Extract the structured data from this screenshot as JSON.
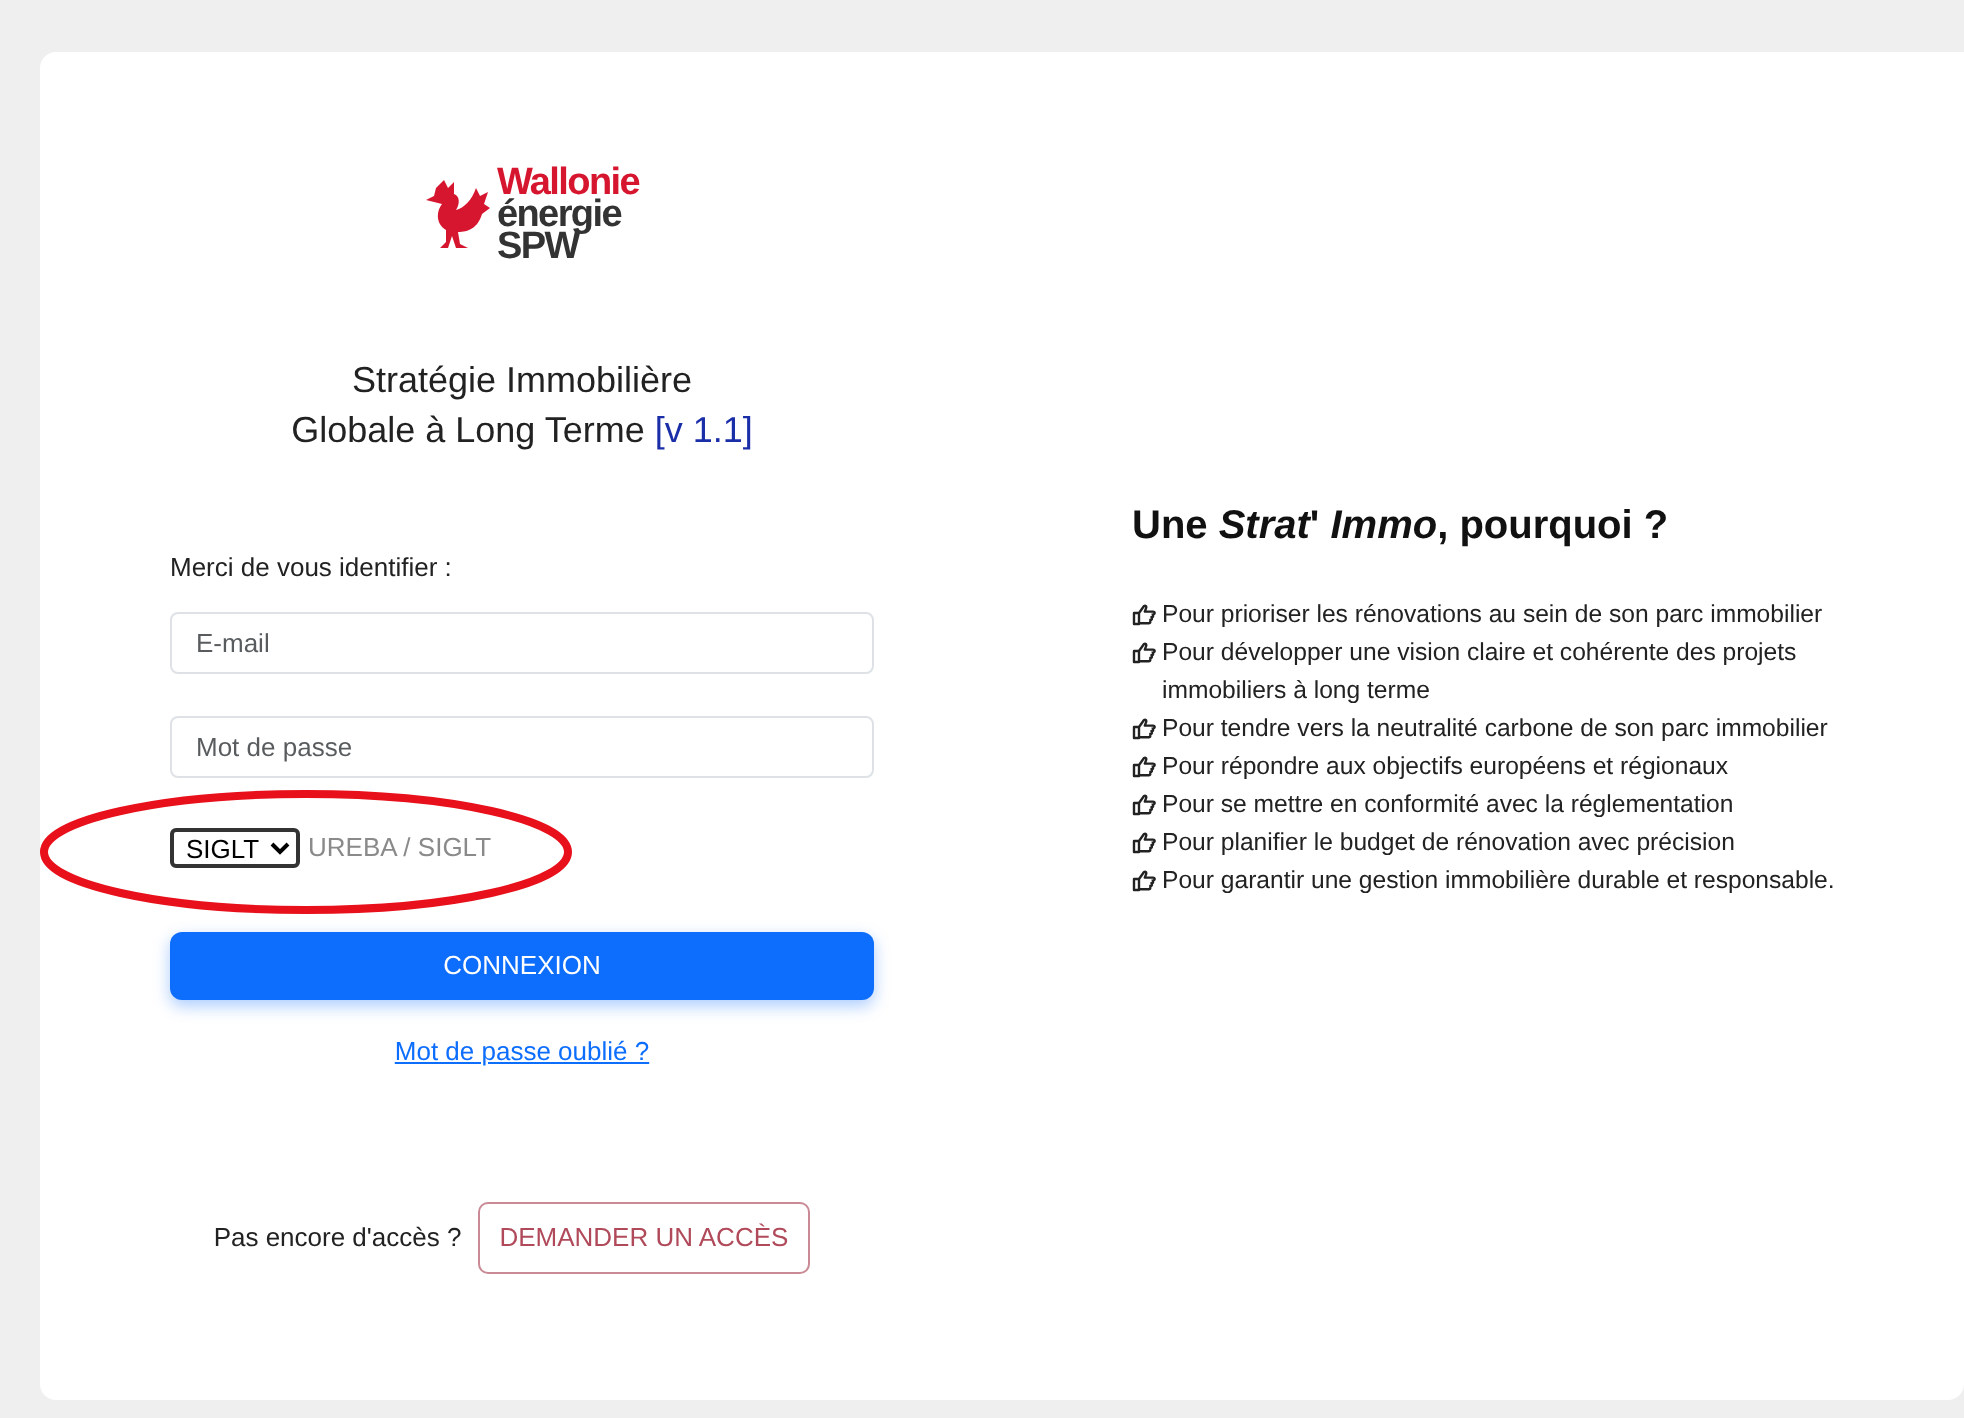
{
  "logo": {
    "lines": [
      "Wallonie",
      "énergie",
      "SPW"
    ]
  },
  "title": {
    "lines": [
      "Stratégie Immobilière",
      "Globale à Long Terme"
    ],
    "version": "[v 1.1]"
  },
  "login": {
    "prompt": "Merci de vous identifier :",
    "email": {
      "placeholder": "E-mail"
    },
    "password": {
      "placeholder": "Mot de passe"
    },
    "system_select": {
      "value": "SIGLT",
      "hint": "UREBA / SIGLT",
      "highlight_ellipse": true
    },
    "submit": "CONNEXION",
    "forgot_link": "Mot de passe oublié ?",
    "no_access": "Pas encore d'accès ?",
    "request_button": "DEMANDER UN ACCÈS"
  },
  "reasons": {
    "heading": "Une *Strat*' *Immo*, pourquoi ?",
    "items": [
      "Pour prioriser les rénovations au sein de son parc immobilier",
      "Pour développer une vision claire et cohérente des projets immobiliers à long terme",
      "Pour tendre vers la neutralité carbone de son parc immobilier",
      "Pour répondre aux objectifs européens et régionaux",
      "Pour se mettre en conformité avec la réglementation",
      "Pour planifier le budget de rénovation avec précision",
      "Pour garantir une gestion immobilière durable et responsable."
    ]
  }
}
